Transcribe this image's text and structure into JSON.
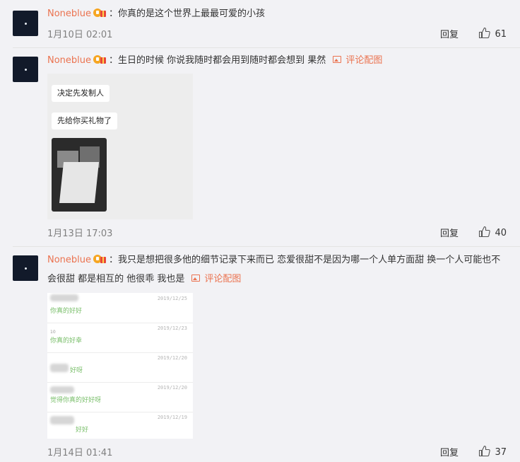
{
  "reply_label": "回复",
  "image_link_label": "评论配图",
  "comments": [
    {
      "username": "Noneblue",
      "text": "你真的是这个世界上最最可爱的小孩",
      "time": "1月10日 02:01",
      "likes": "61"
    },
    {
      "username": "Noneblue",
      "text": "生日的时候 你说我随时都会用到随时都会想到 果然",
      "time": "1月13日 17:03",
      "likes": "40",
      "attachment": {
        "bubbles": [
          "决定先发制人",
          "先给你买礼物了"
        ]
      }
    },
    {
      "username": "Noneblue",
      "text": "我只是想把很多他的细节记录下来而已 恋爱很甜不是因为哪一个人单方面甜 换一个人可能也不会很甜 都是相互的 他很乖 我也是",
      "time": "1月14日 01:41",
      "likes": "37",
      "attachment": {
        "rows": [
          {
            "date": "2019/12/25",
            "msg": "你真的好好",
            "num": ""
          },
          {
            "date": "2019/12/23",
            "msg": "你真的好幸",
            "num": "10"
          },
          {
            "date": "2019/12/20",
            "msg": "好呀",
            "num": ""
          },
          {
            "date": "2019/12/20",
            "msg": "觉得你真的好好呀",
            "num": ""
          },
          {
            "date": "2019/12/19",
            "msg": "好好",
            "num": ""
          }
        ]
      }
    }
  ]
}
